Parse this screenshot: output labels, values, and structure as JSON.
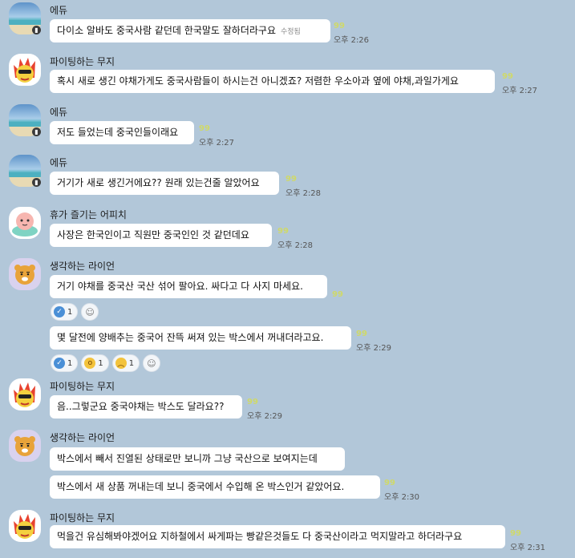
{
  "users": {
    "edu": "에듀",
    "muzi": "파이팅하는 무지",
    "apeach": "휴가 즐기는 어피치",
    "ryan": "생각하는 라이언"
  },
  "messages": {
    "m1": {
      "text": "다이소 알바도 중국사람 같던데 한국말도 잘하더라구요",
      "edited": "수정됨",
      "unread": "99",
      "time": "오후 2:26"
    },
    "m2": {
      "text": "혹시 새로 생긴 야채가게도 중국사람들이 하시는건 아니겠죠? 저렴한 우소아과 옆에 야채,과일가게요",
      "unread": "99",
      "time": "오후 2:27"
    },
    "m3": {
      "text": "저도 들었는데 중국인들이래요",
      "unread": "99",
      "time": "오후 2:27"
    },
    "m4": {
      "text": "거기가 새로 생긴거에요?? 원래 있는건줄 알았어요",
      "unread": "99",
      "time": "오후 2:28"
    },
    "m5": {
      "text": "사장은 한국인이고 직원만 중국인인 것 같던데요",
      "unread": "99",
      "time": "오후 2:28"
    },
    "m6": {
      "text": "거기 야채를 중국산 국산 섞어 팔아요. 싸다고 다 사지 마세요.",
      "unread": "99",
      "react_check": "1"
    },
    "m7": {
      "text": "몇 달전에 양배추는 중국어 잔뜩 써져 있는 박스에서 꺼내더라고요.",
      "unread": "99",
      "time": "오후 2:29",
      "react_check": "1",
      "react_wow": "1",
      "react_sad": "1"
    },
    "m8": {
      "text": "음..그렇군요 중국야채는 박스도 달라요??",
      "unread": "99",
      "time": "오후 2:29"
    },
    "m9": {
      "text": "박스에서 빼서 진열된 상태로만 보니까 그냥 국산으로 보여지는데"
    },
    "m10": {
      "text": "박스에서 새 상품 꺼내는데 보니 중국에서  수입해 온  박스인거 같았어요.",
      "unread": "99",
      "time": "오후 2:30"
    },
    "m11": {
      "text": "먹을건 유심해봐야겠어요 지하철에서 싸게파는 빵같은것들도 다 중국산이라고 먹지말라고 하더라구요",
      "unread": "99",
      "time": "오후 2:31"
    }
  }
}
